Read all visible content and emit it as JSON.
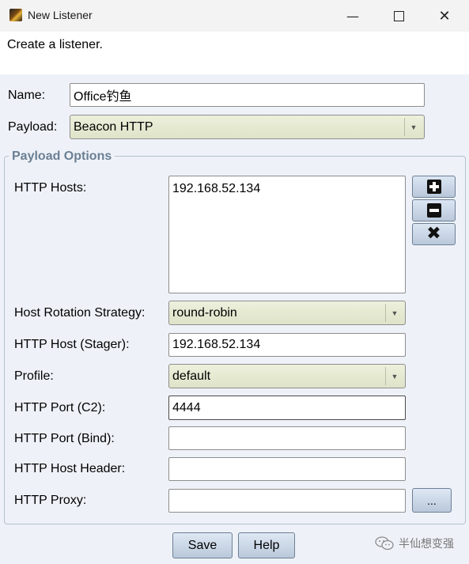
{
  "window": {
    "title": "New Listener",
    "minimize_icon": "minimize-icon",
    "maximize_icon": "maximize-icon",
    "close_icon": "close-icon"
  },
  "description": "Create a listener.",
  "name": {
    "label": "Name:",
    "value": "Office钓鱼"
  },
  "payload": {
    "label": "Payload:",
    "value": "Beacon HTTP"
  },
  "payload_options": {
    "title": "Payload Options",
    "http_hosts": {
      "label": "HTTP Hosts:",
      "items": [
        "192.168.52.134"
      ]
    },
    "host_rotation": {
      "label": "Host Rotation Strategy:",
      "value": "round-robin"
    },
    "http_host_stager": {
      "label": "HTTP Host (Stager):",
      "value": "192.168.52.134"
    },
    "profile": {
      "label": "Profile:",
      "value": "default"
    },
    "http_port_c2": {
      "label": "HTTP Port (C2):",
      "value": "4444"
    },
    "http_port_bind": {
      "label": "HTTP Port (Bind):",
      "value": ""
    },
    "http_host_header": {
      "label": "HTTP Host Header:",
      "value": ""
    },
    "http_proxy": {
      "label": "HTTP Proxy:",
      "value": "",
      "browse_label": "..."
    }
  },
  "buttons": {
    "save": "Save",
    "help": "Help"
  },
  "watermark": "半仙想变强",
  "colors": {
    "group_title": "#6b7f94",
    "combo_bg": "#e6e9d2",
    "button_bg": "#c8d5e6"
  }
}
